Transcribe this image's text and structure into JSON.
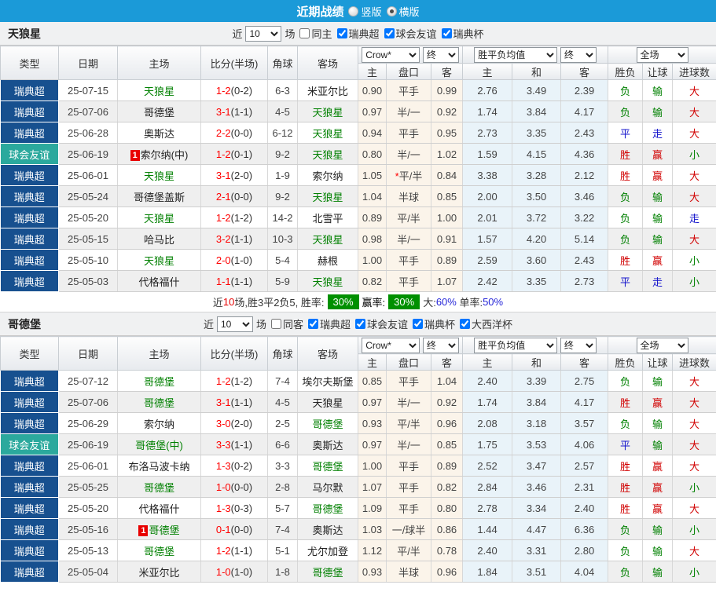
{
  "title_bar": {
    "title": "近期战绩",
    "radio_vertical": "竖版",
    "radio_horizontal": "横版",
    "selected": "横版",
    "bar_color": "#1b9ad8"
  },
  "table_header": {
    "static_cols": [
      "类型",
      "日期",
      "主场",
      "比分(半场)",
      "角球",
      "客场"
    ],
    "sub_cols": [
      "主",
      "盘口",
      "客",
      "主",
      "和",
      "客",
      "胜负",
      "让球",
      "进球数"
    ],
    "selects": {
      "bookmaker": "Crow*",
      "stage": "终",
      "avg": "胜平负均值",
      "scope": "全场"
    }
  },
  "colors": {
    "type_map": {
      "瑞典超": "#17508f",
      "球会友谊": "#2ba99d"
    },
    "focus_team": "#008000",
    "normal_team": "#222222",
    "score_ft": "#ff0000",
    "result_map": {
      "胜": "#d10000",
      "赢": "#d10000",
      "大": "#d10000",
      "平": "#1414cc",
      "走": "#1414cc",
      "负": "#008000",
      "输": "#008000",
      "小": "#008000"
    }
  },
  "sections": [
    {
      "team": "天狼星",
      "filter": {
        "near_label": "近",
        "count": "10",
        "field_label": "场",
        "same_label": "同主",
        "same_checked": false,
        "leagues": [
          {
            "label": "瑞典超",
            "checked": true
          },
          {
            "label": "球会友谊",
            "checked": true
          },
          {
            "label": "瑞典杯",
            "checked": true
          }
        ]
      },
      "rows": [
        {
          "type": "瑞典超",
          "date": "25-07-15",
          "home": "天狼星",
          "hf": true,
          "hr": false,
          "ft": "1-2",
          "hts": "(0-2)",
          "cor": "6-3",
          "away": "米亚尔比",
          "af": false,
          "o1": "0.90",
          "h": "平手",
          "o2": "0.99",
          "e1": "2.76",
          "e2": "3.49",
          "e3": "2.39",
          "r": [
            "负",
            "输",
            "大"
          ]
        },
        {
          "type": "瑞典超",
          "date": "25-07-06",
          "home": "哥德堡",
          "hf": false,
          "hr": false,
          "ft": "3-1",
          "hts": "(1-1)",
          "cor": "4-5",
          "away": "天狼星",
          "af": true,
          "o1": "0.97",
          "h": "半/一",
          "o2": "0.92",
          "e1": "1.74",
          "e2": "3.84",
          "e3": "4.17",
          "r": [
            "负",
            "输",
            "大"
          ]
        },
        {
          "type": "瑞典超",
          "date": "25-06-28",
          "home": "奥斯达",
          "hf": false,
          "hr": false,
          "ft": "2-2",
          "hts": "(0-0)",
          "cor": "6-12",
          "away": "天狼星",
          "af": true,
          "o1": "0.94",
          "h": "平手",
          "o2": "0.95",
          "e1": "2.73",
          "e2": "3.35",
          "e3": "2.43",
          "r": [
            "平",
            "走",
            "大"
          ]
        },
        {
          "type": "球会友谊",
          "date": "25-06-19",
          "home": "索尔纳(中)",
          "hf": false,
          "hr": true,
          "ft": "1-2",
          "hts": "(0-1)",
          "cor": "9-2",
          "away": "天狼星",
          "af": true,
          "o1": "0.80",
          "h": "半/一",
          "o2": "1.02",
          "e1": "1.59",
          "e2": "4.15",
          "e3": "4.36",
          "r": [
            "胜",
            "赢",
            "小"
          ]
        },
        {
          "type": "瑞典超",
          "date": "25-06-01",
          "home": "天狼星",
          "hf": true,
          "hr": false,
          "ft": "3-1",
          "hts": "(2-0)",
          "cor": "1-9",
          "away": "索尔纳",
          "af": false,
          "o1": "1.05",
          "h": "*平/半",
          "o2": "0.84",
          "e1": "3.38",
          "e2": "3.28",
          "e3": "2.12",
          "r": [
            "胜",
            "赢",
            "大"
          ]
        },
        {
          "type": "瑞典超",
          "date": "25-05-24",
          "home": "哥德堡盖斯",
          "hf": false,
          "hr": false,
          "ft": "2-1",
          "hts": "(0-0)",
          "cor": "9-2",
          "away": "天狼星",
          "af": true,
          "o1": "1.04",
          "h": "半球",
          "o2": "0.85",
          "e1": "2.00",
          "e2": "3.50",
          "e3": "3.46",
          "r": [
            "负",
            "输",
            "大"
          ]
        },
        {
          "type": "瑞典超",
          "date": "25-05-20",
          "home": "天狼星",
          "hf": true,
          "hr": false,
          "ft": "1-2",
          "hts": "(1-2)",
          "cor": "14-2",
          "away": "北雪平",
          "af": false,
          "o1": "0.89",
          "h": "平/半",
          "o2": "1.00",
          "e1": "2.01",
          "e2": "3.72",
          "e3": "3.22",
          "r": [
            "负",
            "输",
            "走"
          ]
        },
        {
          "type": "瑞典超",
          "date": "25-05-15",
          "home": "哈马比",
          "hf": false,
          "hr": false,
          "ft": "3-2",
          "hts": "(1-1)",
          "cor": "10-3",
          "away": "天狼星",
          "af": true,
          "o1": "0.98",
          "h": "半/一",
          "o2": "0.91",
          "e1": "1.57",
          "e2": "4.20",
          "e3": "5.14",
          "r": [
            "负",
            "输",
            "大"
          ]
        },
        {
          "type": "瑞典超",
          "date": "25-05-10",
          "home": "天狼星",
          "hf": true,
          "hr": false,
          "ft": "2-0",
          "hts": "(1-0)",
          "cor": "5-4",
          "away": "赫根",
          "af": false,
          "o1": "1.00",
          "h": "平手",
          "o2": "0.89",
          "e1": "2.59",
          "e2": "3.60",
          "e3": "2.43",
          "r": [
            "胜",
            "赢",
            "小"
          ]
        },
        {
          "type": "瑞典超",
          "date": "25-05-03",
          "home": "代格福什",
          "hf": false,
          "hr": false,
          "ft": "1-1",
          "hts": "(1-1)",
          "cor": "5-9",
          "away": "天狼星",
          "af": true,
          "o1": "0.82",
          "h": "平手",
          "o2": "1.07",
          "e1": "2.42",
          "e2": "3.35",
          "e3": "2.73",
          "r": [
            "平",
            "走",
            "小"
          ]
        }
      ],
      "summary": {
        "segments": [
          {
            "text": "近",
            "color": "#333333"
          },
          {
            "text": "10",
            "color": "#e60000"
          },
          {
            "text": "场,胜3平2负5, 胜率:",
            "color": "#333333"
          }
        ],
        "badge1": "30%",
        "between": "赢率:",
        "badge2": "30%",
        "segments_tail": [
          {
            "text": "大:",
            "color": "#333333"
          },
          {
            "text": "60%",
            "color": "#2626d8"
          },
          {
            "text": " 单率:",
            "color": "#333333"
          },
          {
            "text": "50%",
            "color": "#2626d8"
          }
        ]
      }
    },
    {
      "team": "哥德堡",
      "filter": {
        "near_label": "近",
        "count": "10",
        "field_label": "场",
        "same_label": "同客",
        "same_checked": false,
        "leagues": [
          {
            "label": "瑞典超",
            "checked": true
          },
          {
            "label": "球会友谊",
            "checked": true
          },
          {
            "label": "瑞典杯",
            "checked": true
          },
          {
            "label": "大西洋杯",
            "checked": true
          }
        ]
      },
      "rows": [
        {
          "type": "瑞典超",
          "date": "25-07-12",
          "home": "哥德堡",
          "hf": true,
          "hr": false,
          "ft": "1-2",
          "hts": "(1-2)",
          "cor": "7-4",
          "away": "埃尔夫斯堡",
          "af": false,
          "o1": "0.85",
          "h": "平手",
          "o2": "1.04",
          "e1": "2.40",
          "e2": "3.39",
          "e3": "2.75",
          "r": [
            "负",
            "输",
            "大"
          ]
        },
        {
          "type": "瑞典超",
          "date": "25-07-06",
          "home": "哥德堡",
          "hf": true,
          "hr": false,
          "ft": "3-1",
          "hts": "(1-1)",
          "cor": "4-5",
          "away": "天狼星",
          "af": false,
          "o1": "0.97",
          "h": "半/一",
          "o2": "0.92",
          "e1": "1.74",
          "e2": "3.84",
          "e3": "4.17",
          "r": [
            "胜",
            "赢",
            "大"
          ]
        },
        {
          "type": "瑞典超",
          "date": "25-06-29",
          "home": "索尔纳",
          "hf": false,
          "hr": false,
          "ft": "3-0",
          "hts": "(2-0)",
          "cor": "2-5",
          "away": "哥德堡",
          "af": true,
          "o1": "0.93",
          "h": "平/半",
          "o2": "0.96",
          "e1": "2.08",
          "e2": "3.18",
          "e3": "3.57",
          "r": [
            "负",
            "输",
            "大"
          ]
        },
        {
          "type": "球会友谊",
          "date": "25-06-19",
          "home": "哥德堡(中)",
          "hf": true,
          "hr": false,
          "ft": "3-3",
          "hts": "(1-1)",
          "cor": "6-6",
          "away": "奥斯达",
          "af": false,
          "o1": "0.97",
          "h": "半/一",
          "o2": "0.85",
          "e1": "1.75",
          "e2": "3.53",
          "e3": "4.06",
          "r": [
            "平",
            "输",
            "大"
          ]
        },
        {
          "type": "瑞典超",
          "date": "25-06-01",
          "home": "布洛马波卡纳",
          "hf": false,
          "hr": false,
          "ft": "1-3",
          "hts": "(0-2)",
          "cor": "3-3",
          "away": "哥德堡",
          "af": true,
          "o1": "1.00",
          "h": "平手",
          "o2": "0.89",
          "e1": "2.52",
          "e2": "3.47",
          "e3": "2.57",
          "r": [
            "胜",
            "赢",
            "大"
          ]
        },
        {
          "type": "瑞典超",
          "date": "25-05-25",
          "home": "哥德堡",
          "hf": true,
          "hr": false,
          "ft": "1-0",
          "hts": "(0-0)",
          "cor": "2-8",
          "away": "马尔默",
          "af": false,
          "o1": "1.07",
          "h": "平手",
          "o2": "0.82",
          "e1": "2.84",
          "e2": "3.46",
          "e3": "2.31",
          "r": [
            "胜",
            "赢",
            "小"
          ]
        },
        {
          "type": "瑞典超",
          "date": "25-05-20",
          "home": "代格福什",
          "hf": false,
          "hr": false,
          "ft": "1-3",
          "hts": "(0-3)",
          "cor": "5-7",
          "away": "哥德堡",
          "af": true,
          "o1": "1.09",
          "h": "平手",
          "o2": "0.80",
          "e1": "2.78",
          "e2": "3.34",
          "e3": "2.40",
          "r": [
            "胜",
            "赢",
            "大"
          ]
        },
        {
          "type": "瑞典超",
          "date": "25-05-16",
          "home": "哥德堡",
          "hf": true,
          "hr": true,
          "ft": "0-1",
          "hts": "(0-0)",
          "cor": "7-4",
          "away": "奥斯达",
          "af": false,
          "o1": "1.03",
          "h": "一/球半",
          "o2": "0.86",
          "e1": "1.44",
          "e2": "4.47",
          "e3": "6.36",
          "r": [
            "负",
            "输",
            "小"
          ]
        },
        {
          "type": "瑞典超",
          "date": "25-05-13",
          "home": "哥德堡",
          "hf": true,
          "hr": false,
          "ft": "1-2",
          "hts": "(1-1)",
          "cor": "5-1",
          "away": "尤尔加登",
          "af": false,
          "o1": "1.12",
          "h": "平/半",
          "o2": "0.78",
          "e1": "2.40",
          "e2": "3.31",
          "e3": "2.80",
          "r": [
            "负",
            "输",
            "大"
          ]
        },
        {
          "type": "瑞典超",
          "date": "25-05-04",
          "home": "米亚尔比",
          "hf": false,
          "hr": false,
          "ft": "1-0",
          "hts": "(1-0)",
          "cor": "1-8",
          "away": "哥德堡",
          "af": true,
          "o1": "0.93",
          "h": "半球",
          "o2": "0.96",
          "e1": "1.84",
          "e2": "3.51",
          "e3": "4.04",
          "r": [
            "负",
            "输",
            "小"
          ]
        }
      ],
      "summary": null
    }
  ]
}
